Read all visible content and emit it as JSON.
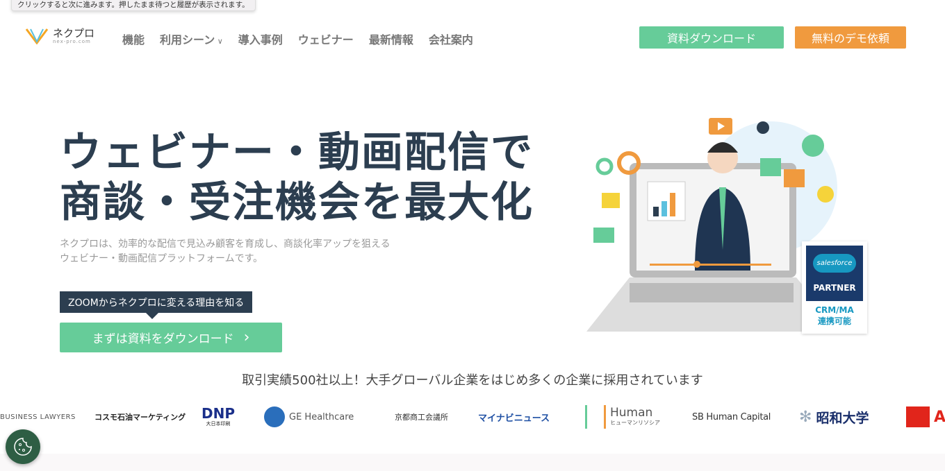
{
  "tooltip": "クリックすると次に進みます。押したまま待つと履歴が表示されます。",
  "logo": {
    "name": "ネクプロ",
    "domain": "nex-pro.com"
  },
  "nav": [
    {
      "label": "機能"
    },
    {
      "label": "利用シーン"
    },
    {
      "label": "導入事例"
    },
    {
      "label": "ウェビナー"
    },
    {
      "label": "最新情報"
    },
    {
      "label": "会社案内"
    }
  ],
  "header": {
    "download": "資料ダウンロード",
    "demo": "無料のデモ依頼"
  },
  "hero": {
    "title1": "ウェビナー・動画配信で",
    "title2": "商談・受注機会を最大化",
    "sub1": "ネクプロは、効率的な配信で見込み顧客を育成し、商談化率アップを狙える",
    "sub2": "ウェビナー・動画配信プラットフォームです。",
    "badge": "ZOOMからネクプロに変える理由を知る",
    "cta": "まずは資料をダウンロード"
  },
  "partner": {
    "brand": "salesforce",
    "label": "PARTNER",
    "line1": "CRM/MA",
    "line2": "連携可能"
  },
  "record": "取引実績500社以上！大手グローバル企業をはじめ多くの企業に採用されています",
  "clients": [
    "BUSINESS LAWYERS",
    "コスモ石油マーケティング",
    "DNP",
    "大日本印刷",
    "GE Healthcare",
    "京都商工会議所",
    "マイナビニュース",
    "Human",
    "ヒューマンリソシア",
    "SB Human Capital",
    "昭和大学",
    "A"
  ],
  "colors": {
    "green": "#66cc99",
    "orange": "#f09a3e",
    "navy": "#2c3e50",
    "cookie": "#2e5e44"
  }
}
